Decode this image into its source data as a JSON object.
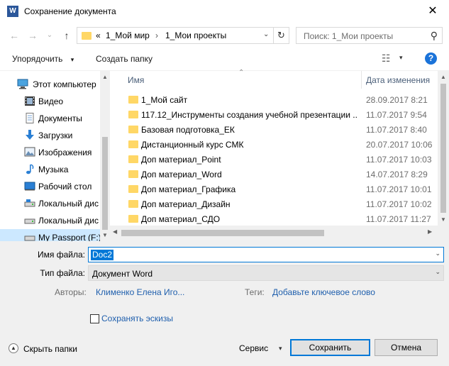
{
  "window": {
    "title": "Сохранение документа",
    "app_icon_letter": "W",
    "close_glyph": "✕"
  },
  "nav": {
    "back_glyph": "←",
    "forward_glyph": "→",
    "recent_glyph": "⌄",
    "up_glyph": "↑",
    "breadcrumb_overflow": "«",
    "breadcrumb": [
      "1_Мой мир",
      "1_Мои проекты"
    ],
    "breadcrumb_sep": "›",
    "refresh_glyph": "↻",
    "search_placeholder": "Поиск: 1_Мои проекты",
    "search_glyph": "⚲"
  },
  "toolbar": {
    "organize_label": "Упорядочить",
    "organize_caret": "▾",
    "new_folder_label": "Создать папку",
    "view_glyph": "☷",
    "view_caret": "▾",
    "help_label": "?"
  },
  "sidebar": {
    "items": [
      {
        "label": "Этот компьютер",
        "icon": "computer-icon"
      },
      {
        "label": "Видео",
        "icon": "video-icon"
      },
      {
        "label": "Документы",
        "icon": "documents-icon"
      },
      {
        "label": "Загрузки",
        "icon": "downloads-icon"
      },
      {
        "label": "Изображения",
        "icon": "pictures-icon"
      },
      {
        "label": "Музыка",
        "icon": "music-icon"
      },
      {
        "label": "Рабочий стол",
        "icon": "desktop-icon"
      },
      {
        "label": "Локальный дис",
        "icon": "drive-icon"
      },
      {
        "label": "Локальный дис",
        "icon": "drive-icon"
      },
      {
        "label": "My Passport (F:)",
        "icon": "drive-icon"
      }
    ]
  },
  "columns": {
    "name": "Имя",
    "date": "Дата изменения",
    "sort_caret": "⌃"
  },
  "files": [
    {
      "name": "1_Мой сайт",
      "date": "28.09.2017 8:21"
    },
    {
      "name": "117.12_Инструменты создания учебной презентации ...",
      "date": "11.07.2017 9:54"
    },
    {
      "name": "Базовая подготовка_ЕК",
      "date": "11.07.2017 8:40"
    },
    {
      "name": "Дистанционный курс СМК",
      "date": "20.07.2017 10:06"
    },
    {
      "name": "Доп материал_Point",
      "date": "11.07.2017 10:03"
    },
    {
      "name": "Доп материал_Word",
      "date": "14.07.2017 8:29"
    },
    {
      "name": "Доп материал_Графика",
      "date": "11.07.2017 10:01"
    },
    {
      "name": "Доп материал_Дизайн",
      "date": "11.07.2017 10:02"
    },
    {
      "name": "Доп материал_СДО",
      "date": "11.07.2017 11:27"
    }
  ],
  "scroll_arrows": {
    "up": "▲",
    "down": "▼",
    "left": "◀",
    "right": "▶"
  },
  "form": {
    "filename_label": "Имя файла:",
    "filename_value": "Doc2",
    "filetype_label": "Тип файла:",
    "filetype_value": "Документ Word",
    "dropdown_caret": "⌄",
    "authors_label": "Авторы:",
    "authors_value": "Клименко Елена Иго...",
    "tags_label": "Теги:",
    "tags_value": "Добавьте ключевое слово",
    "thumbnails_label": "Сохранять эскизы",
    "hide_folders_glyph": "▲",
    "hide_folders_label": "Скрыть папки",
    "tools_label": "Сервис",
    "tools_caret": "▾",
    "save_label": "Сохранить",
    "cancel_label": "Отмена"
  },
  "colors": {
    "accent": "#0078d7",
    "folder": "#ffd766",
    "link": "#1f5fad"
  }
}
